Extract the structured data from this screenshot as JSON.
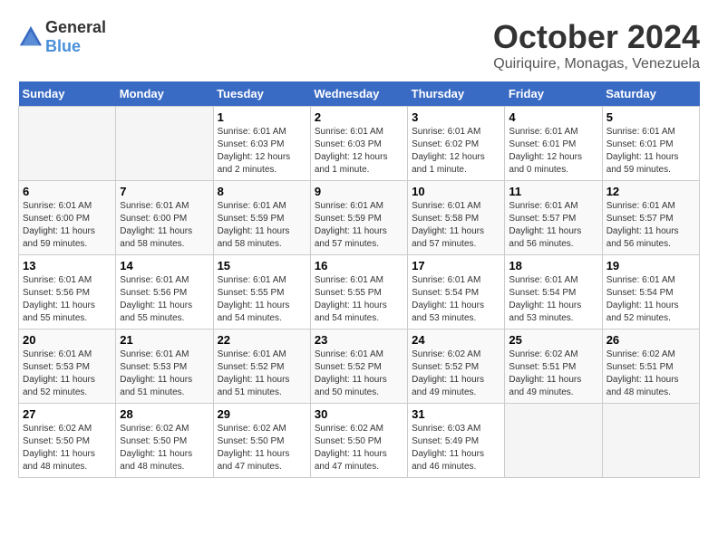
{
  "header": {
    "logo_general": "General",
    "logo_blue": "Blue",
    "month": "October 2024",
    "location": "Quiriquire, Monagas, Venezuela"
  },
  "weekdays": [
    "Sunday",
    "Monday",
    "Tuesday",
    "Wednesday",
    "Thursday",
    "Friday",
    "Saturday"
  ],
  "weeks": [
    [
      {
        "day": "",
        "empty": true
      },
      {
        "day": "",
        "empty": true
      },
      {
        "day": "1",
        "sunrise": "Sunrise: 6:01 AM",
        "sunset": "Sunset: 6:03 PM",
        "daylight": "Daylight: 12 hours and 2 minutes."
      },
      {
        "day": "2",
        "sunrise": "Sunrise: 6:01 AM",
        "sunset": "Sunset: 6:03 PM",
        "daylight": "Daylight: 12 hours and 1 minute."
      },
      {
        "day": "3",
        "sunrise": "Sunrise: 6:01 AM",
        "sunset": "Sunset: 6:02 PM",
        "daylight": "Daylight: 12 hours and 1 minute."
      },
      {
        "day": "4",
        "sunrise": "Sunrise: 6:01 AM",
        "sunset": "Sunset: 6:01 PM",
        "daylight": "Daylight: 12 hours and 0 minutes."
      },
      {
        "day": "5",
        "sunrise": "Sunrise: 6:01 AM",
        "sunset": "Sunset: 6:01 PM",
        "daylight": "Daylight: 11 hours and 59 minutes."
      }
    ],
    [
      {
        "day": "6",
        "sunrise": "Sunrise: 6:01 AM",
        "sunset": "Sunset: 6:00 PM",
        "daylight": "Daylight: 11 hours and 59 minutes."
      },
      {
        "day": "7",
        "sunrise": "Sunrise: 6:01 AM",
        "sunset": "Sunset: 6:00 PM",
        "daylight": "Daylight: 11 hours and 58 minutes."
      },
      {
        "day": "8",
        "sunrise": "Sunrise: 6:01 AM",
        "sunset": "Sunset: 5:59 PM",
        "daylight": "Daylight: 11 hours and 58 minutes."
      },
      {
        "day": "9",
        "sunrise": "Sunrise: 6:01 AM",
        "sunset": "Sunset: 5:59 PM",
        "daylight": "Daylight: 11 hours and 57 minutes."
      },
      {
        "day": "10",
        "sunrise": "Sunrise: 6:01 AM",
        "sunset": "Sunset: 5:58 PM",
        "daylight": "Daylight: 11 hours and 57 minutes."
      },
      {
        "day": "11",
        "sunrise": "Sunrise: 6:01 AM",
        "sunset": "Sunset: 5:57 PM",
        "daylight": "Daylight: 11 hours and 56 minutes."
      },
      {
        "day": "12",
        "sunrise": "Sunrise: 6:01 AM",
        "sunset": "Sunset: 5:57 PM",
        "daylight": "Daylight: 11 hours and 56 minutes."
      }
    ],
    [
      {
        "day": "13",
        "sunrise": "Sunrise: 6:01 AM",
        "sunset": "Sunset: 5:56 PM",
        "daylight": "Daylight: 11 hours and 55 minutes."
      },
      {
        "day": "14",
        "sunrise": "Sunrise: 6:01 AM",
        "sunset": "Sunset: 5:56 PM",
        "daylight": "Daylight: 11 hours and 55 minutes."
      },
      {
        "day": "15",
        "sunrise": "Sunrise: 6:01 AM",
        "sunset": "Sunset: 5:55 PM",
        "daylight": "Daylight: 11 hours and 54 minutes."
      },
      {
        "day": "16",
        "sunrise": "Sunrise: 6:01 AM",
        "sunset": "Sunset: 5:55 PM",
        "daylight": "Daylight: 11 hours and 54 minutes."
      },
      {
        "day": "17",
        "sunrise": "Sunrise: 6:01 AM",
        "sunset": "Sunset: 5:54 PM",
        "daylight": "Daylight: 11 hours and 53 minutes."
      },
      {
        "day": "18",
        "sunrise": "Sunrise: 6:01 AM",
        "sunset": "Sunset: 5:54 PM",
        "daylight": "Daylight: 11 hours and 53 minutes."
      },
      {
        "day": "19",
        "sunrise": "Sunrise: 6:01 AM",
        "sunset": "Sunset: 5:54 PM",
        "daylight": "Daylight: 11 hours and 52 minutes."
      }
    ],
    [
      {
        "day": "20",
        "sunrise": "Sunrise: 6:01 AM",
        "sunset": "Sunset: 5:53 PM",
        "daylight": "Daylight: 11 hours and 52 minutes."
      },
      {
        "day": "21",
        "sunrise": "Sunrise: 6:01 AM",
        "sunset": "Sunset: 5:53 PM",
        "daylight": "Daylight: 11 hours and 51 minutes."
      },
      {
        "day": "22",
        "sunrise": "Sunrise: 6:01 AM",
        "sunset": "Sunset: 5:52 PM",
        "daylight": "Daylight: 11 hours and 51 minutes."
      },
      {
        "day": "23",
        "sunrise": "Sunrise: 6:01 AM",
        "sunset": "Sunset: 5:52 PM",
        "daylight": "Daylight: 11 hours and 50 minutes."
      },
      {
        "day": "24",
        "sunrise": "Sunrise: 6:02 AM",
        "sunset": "Sunset: 5:52 PM",
        "daylight": "Daylight: 11 hours and 49 minutes."
      },
      {
        "day": "25",
        "sunrise": "Sunrise: 6:02 AM",
        "sunset": "Sunset: 5:51 PM",
        "daylight": "Daylight: 11 hours and 49 minutes."
      },
      {
        "day": "26",
        "sunrise": "Sunrise: 6:02 AM",
        "sunset": "Sunset: 5:51 PM",
        "daylight": "Daylight: 11 hours and 48 minutes."
      }
    ],
    [
      {
        "day": "27",
        "sunrise": "Sunrise: 6:02 AM",
        "sunset": "Sunset: 5:50 PM",
        "daylight": "Daylight: 11 hours and 48 minutes."
      },
      {
        "day": "28",
        "sunrise": "Sunrise: 6:02 AM",
        "sunset": "Sunset: 5:50 PM",
        "daylight": "Daylight: 11 hours and 48 minutes."
      },
      {
        "day": "29",
        "sunrise": "Sunrise: 6:02 AM",
        "sunset": "Sunset: 5:50 PM",
        "daylight": "Daylight: 11 hours and 47 minutes."
      },
      {
        "day": "30",
        "sunrise": "Sunrise: 6:02 AM",
        "sunset": "Sunset: 5:50 PM",
        "daylight": "Daylight: 11 hours and 47 minutes."
      },
      {
        "day": "31",
        "sunrise": "Sunrise: 6:03 AM",
        "sunset": "Sunset: 5:49 PM",
        "daylight": "Daylight: 11 hours and 46 minutes."
      },
      {
        "day": "",
        "empty": true
      },
      {
        "day": "",
        "empty": true
      }
    ]
  ]
}
